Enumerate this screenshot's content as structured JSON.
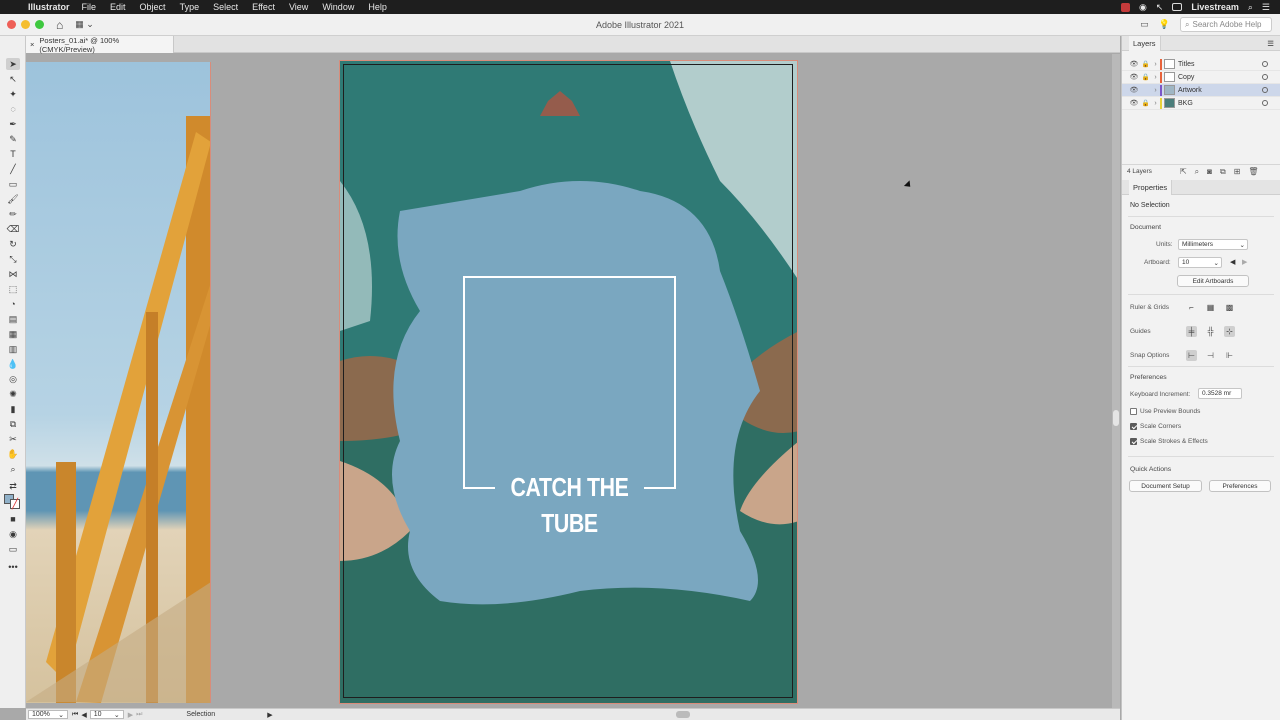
{
  "menubar": {
    "app_name": "Illustrator",
    "items": [
      "File",
      "Edit",
      "Object",
      "Type",
      "Select",
      "Effect",
      "View",
      "Window",
      "Help"
    ],
    "livestream_label": "Livestream"
  },
  "window": {
    "title": "Adobe Illustrator 2021",
    "help_search_placeholder": "Search Adobe Help"
  },
  "document": {
    "tab_label": "Posters_01.ai* @ 100% (CMYK/Preview)",
    "close_glyph": "×"
  },
  "poster": {
    "title": "CATCH THE TUBE"
  },
  "statusbar": {
    "zoom": "100%",
    "artboard": "10",
    "tool": "Selection"
  },
  "layers_panel": {
    "title": "Layers",
    "layers": [
      {
        "name": "Titles",
        "color": "#e8623a",
        "active": false
      },
      {
        "name": "Copy",
        "color": "#e8623a",
        "active": false
      },
      {
        "name": "Artwork",
        "color": "#7b56c8",
        "active": true
      },
      {
        "name": "BKG",
        "color": "#e8d23a",
        "active": false
      }
    ],
    "count_label": "4 Layers"
  },
  "properties_panel": {
    "title": "Properties",
    "selection": "No Selection",
    "document_section": "Document",
    "units_label": "Units:",
    "units_value": "Millimeters",
    "artboard_label": "Artboard:",
    "artboard_value": "10",
    "edit_artboards": "Edit Artboards",
    "ruler_grids": "Ruler & Grids",
    "guides": "Guides",
    "snap_options": "Snap Options",
    "preferences_section": "Preferences",
    "keyboard_increment_label": "Keyboard Increment:",
    "keyboard_increment_value": "0.3528 mr",
    "use_preview_bounds": "Use Preview Bounds",
    "scale_corners": "Scale Corners",
    "scale_strokes": "Scale Strokes & Effects",
    "use_preview_bounds_checked": false,
    "scale_corners_checked": true,
    "scale_strokes_checked": true,
    "quick_actions": "Quick Actions",
    "document_setup": "Document Setup",
    "preferences_button": "Preferences"
  },
  "icons": {
    "apple": "apple-icon",
    "home": "home-icon",
    "eye": "eye-icon",
    "lock": "lock-icon"
  }
}
